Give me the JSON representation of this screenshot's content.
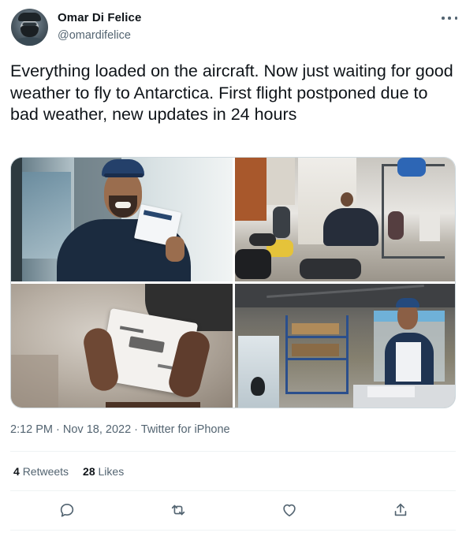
{
  "user": {
    "display_name": "Omar Di Felice",
    "handle": "@omardifelice",
    "avatar_icon": "avatar-icon"
  },
  "tweet": {
    "text": "Everything loaded on the aircraft. Now just waiting for good weather to fly to Antarctica. First flight postponed due to bad weather, new updates in 24 hours",
    "timestamp": "2:12 PM · Nov 18, 2022 · Twitter for iPhone"
  },
  "media": {
    "photos": [
      {
        "alt": "man-with-boarding-pass-photo"
      },
      {
        "alt": "packing-gear-photo"
      },
      {
        "alt": "boarding-pass-closeup-photo"
      },
      {
        "alt": "warehouse-photo"
      }
    ]
  },
  "stats": {
    "retweets_count": "4",
    "retweets_label": "Retweets",
    "likes_count": "28",
    "likes_label": "Likes"
  },
  "actions": [
    {
      "icon": "reply-icon"
    },
    {
      "icon": "retweet-icon"
    },
    {
      "icon": "like-icon"
    },
    {
      "icon": "share-icon"
    }
  ],
  "colors": {
    "primary_text": "#0f1419",
    "secondary_text": "#536471",
    "divider": "#eff3f4"
  }
}
